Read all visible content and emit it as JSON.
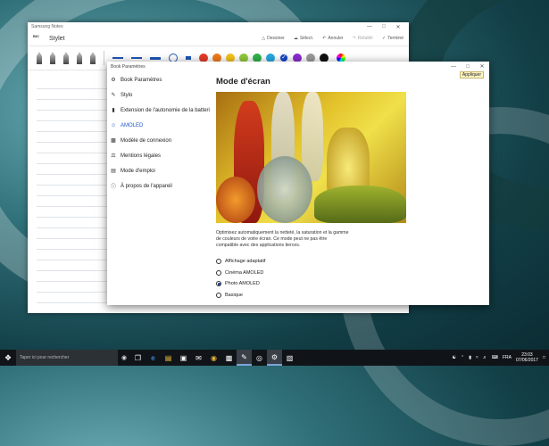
{
  "notes_window": {
    "title": "Samsung Notes",
    "toolbar_title": "Stylet",
    "logo_text": "BIC",
    "actions": [
      {
        "icon": "share-icon",
        "label": "Dessiner"
      },
      {
        "icon": "select-icon",
        "label": "Sélect."
      },
      {
        "icon": "undo-icon",
        "label": "Annuler"
      },
      {
        "icon": "redo-icon",
        "label": "Rétablir"
      },
      {
        "icon": "check-icon",
        "label": "Terminé"
      }
    ],
    "colors": [
      "#e23b2a",
      "#f07a1c",
      "#f2c21a",
      "#8fc93a",
      "#2fb24b",
      "#25a8e0",
      "#1446c8",
      "#8b2bd1",
      "#9a9a9a",
      "#111111"
    ]
  },
  "settings_window": {
    "title": "Book Paramètres",
    "apply_label": "Appliquer",
    "menu": [
      {
        "icon": "settings-book-icon",
        "label": "Book Paramètres",
        "active": false
      },
      {
        "icon": "pen-icon",
        "label": "Stylo",
        "active": false
      },
      {
        "icon": "battery-icon",
        "label": "Extension de l'autonomie de la batteri",
        "active": false
      },
      {
        "icon": "amoled-icon",
        "label": "AMOLED",
        "active": true
      },
      {
        "icon": "connection-icon",
        "label": "Modèle de connexion",
        "active": false
      },
      {
        "icon": "legal-icon",
        "label": "Mentions légales",
        "active": false
      },
      {
        "icon": "manual-icon",
        "label": "Mode d'emploi",
        "active": false
      },
      {
        "icon": "info-icon",
        "label": "À propos de l'appareil",
        "active": false
      }
    ],
    "heading": "Mode d'écran",
    "description": "Optimisez automatiquement la netteté, la saturation et la gamme de couleurs de votre écran. Ce mode peut ne pas être compatible avec des applications tierces.",
    "options": [
      {
        "label": "Affichage adaptatif",
        "checked": false
      },
      {
        "label": "Cinéma AMOLED",
        "checked": false
      },
      {
        "label": "Photo AMOLED",
        "checked": true
      },
      {
        "label": "Basique",
        "checked": false
      }
    ]
  },
  "taskbar": {
    "search_placeholder": "Taper ici pour rechercher",
    "language": "FRA",
    "time": "23:03",
    "date": "07/06/2017"
  }
}
